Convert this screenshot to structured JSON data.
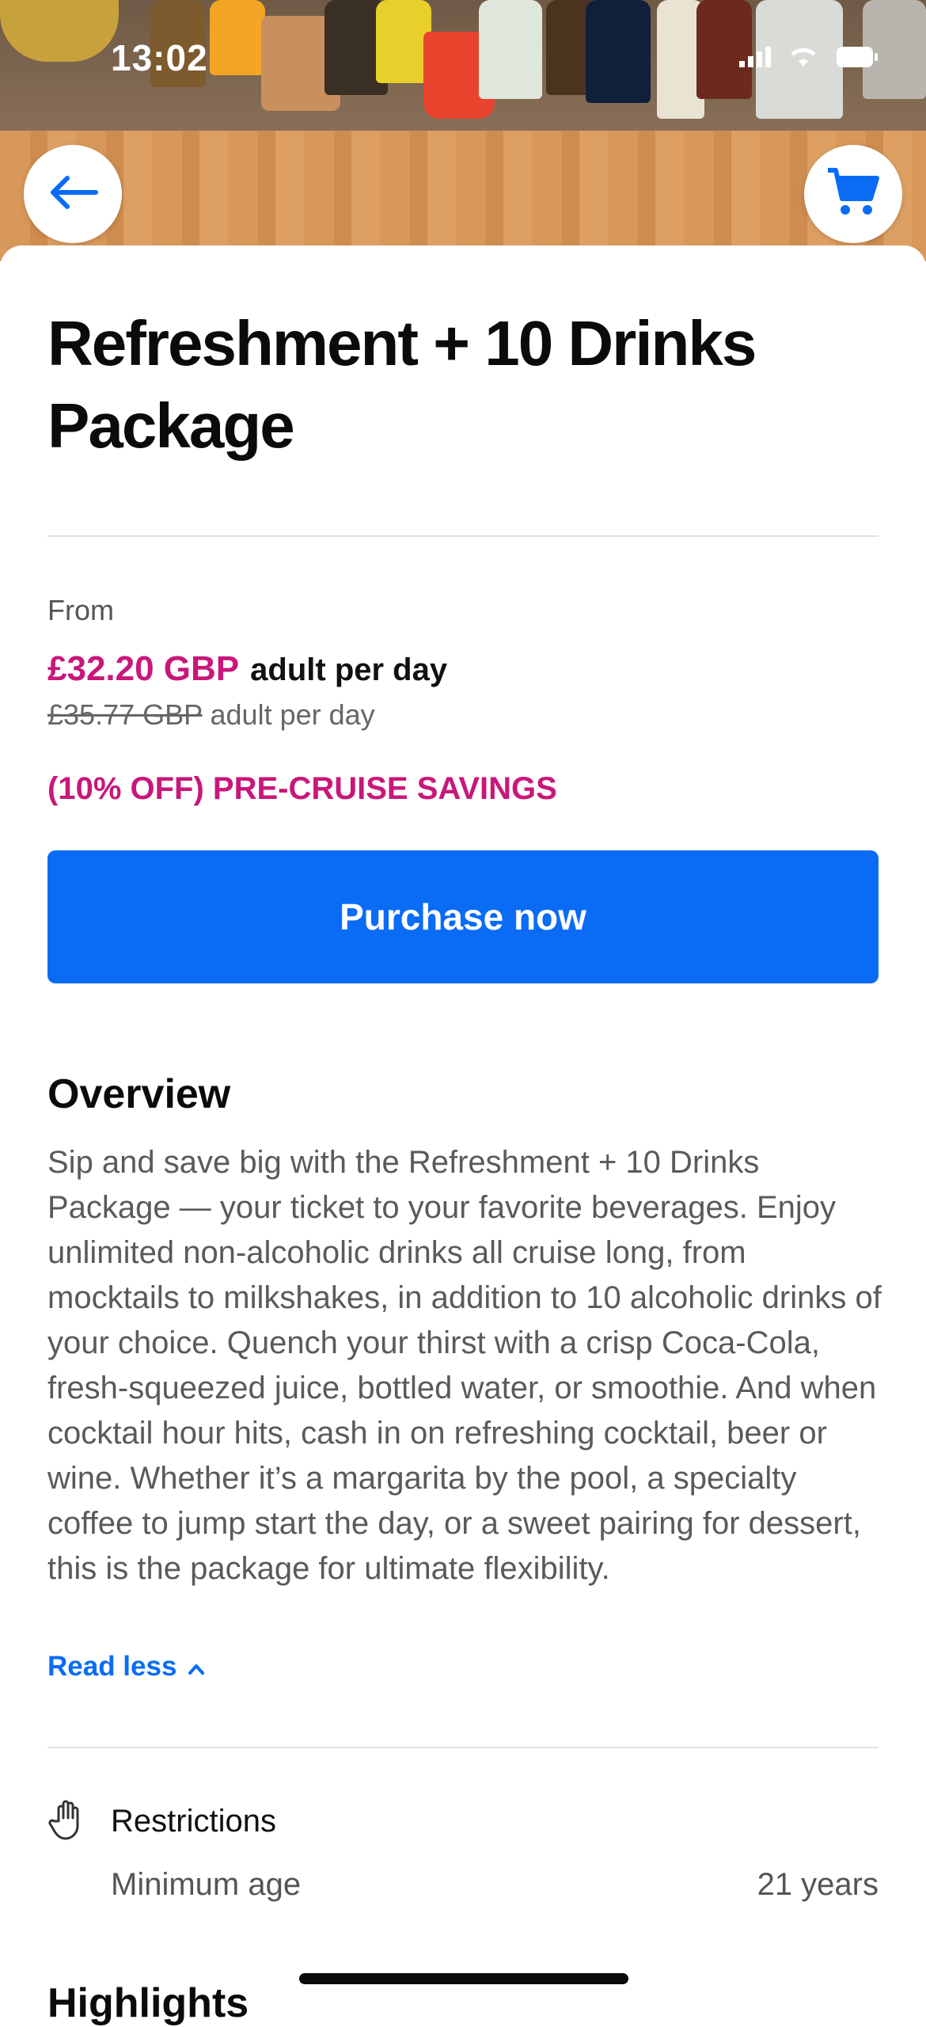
{
  "status_bar": {
    "time": "13:02"
  },
  "hero": {
    "image_icon": "drinks-bar-photo"
  },
  "nav": {
    "back_icon": "arrow-left-icon",
    "cart_icon": "cart-icon"
  },
  "product": {
    "title": "Refreshment + 10 Drinks Package"
  },
  "pricing": {
    "from_label": "From",
    "price": "£32.20 GBP",
    "price_unit": "adult per day",
    "original_price": "£35.77 GBP",
    "original_unit": "adult per day",
    "savings": "(10% OFF) PRE-CRUISE SAVINGS"
  },
  "actions": {
    "purchase_label": "Purchase now"
  },
  "overview": {
    "heading": "Overview",
    "body": "Sip and save big with the Refreshment + 10 Drinks Package — your ticket to your favorite beverages. Enjoy unlimited non-alcoholic drinks all cruise long, from mocktails to milkshakes, in addition to 10 alcoholic drinks of your choice. Quench your thirst with a crisp Coca-Cola, fresh-squeezed juice, bottled water, or smoothie. And when cocktail hour hits, cash in on refreshing cocktail, beer or wine. Whether it’s a margarita by the pool, a specialty coffee to jump start the day, or a sweet pairing for dessert, this is the package for ultimate flexibility.",
    "read_less_label": "Read less"
  },
  "restrictions": {
    "heading": "Restrictions",
    "icon": "hand-icon",
    "items": [
      {
        "label": "Minimum age",
        "value": "21 years"
      }
    ]
  },
  "highlights": {
    "heading": "Highlights"
  },
  "colors": {
    "accent_blue": "#0a6cf5",
    "sale_magenta": "#c8177a"
  }
}
